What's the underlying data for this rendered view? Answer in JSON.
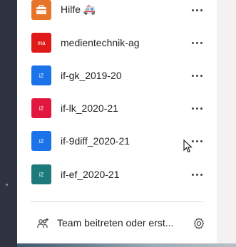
{
  "teams": [
    {
      "name": "Hilfe 🚑",
      "avatar_text": "",
      "avatar_color": "#e8742a",
      "avatar_icon": "briefcase-icon"
    },
    {
      "name": "medientechnik-ag",
      "avatar_text": "ma",
      "avatar_color": "#e01919"
    },
    {
      "name": "if-gk_2019-20",
      "avatar_text": "i2",
      "avatar_color": "#1a73e8"
    },
    {
      "name": "if-lk_2020-21",
      "avatar_text": "i2",
      "avatar_color": "#e3173e"
    },
    {
      "name": "if-9diff_2020-21",
      "avatar_text": "i2",
      "avatar_color": "#1a73e8"
    },
    {
      "name": "if-ef_2020-21",
      "avatar_text": "i2",
      "avatar_color": "#1d7a7a"
    }
  ],
  "footer": {
    "join_label": "Team beitreten oder erst..."
  }
}
